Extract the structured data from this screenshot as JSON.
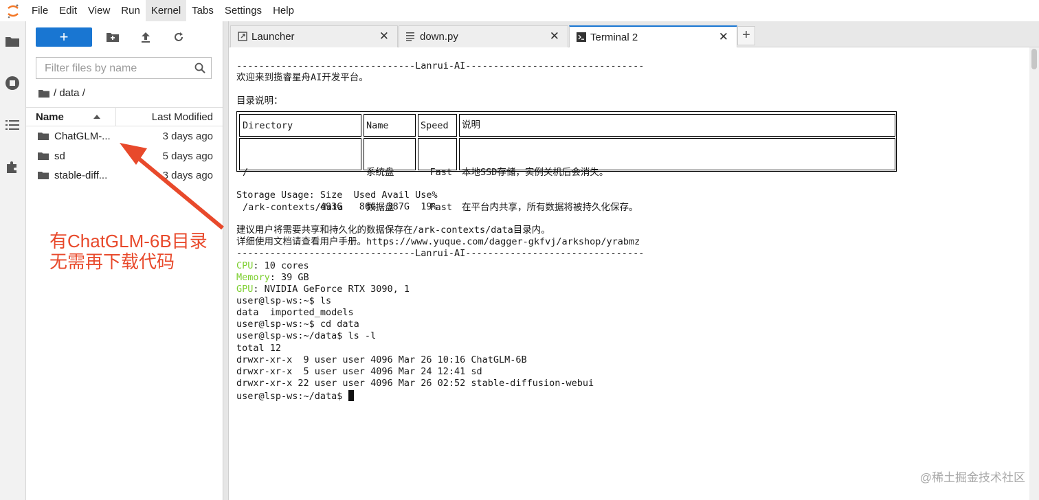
{
  "menu": [
    "File",
    "Edit",
    "View",
    "Run",
    "Kernel",
    "Tabs",
    "Settings",
    "Help"
  ],
  "active_menu_index": 4,
  "filebrowser": {
    "new_label": "+",
    "filter_placeholder": "Filter files by name",
    "breadcrumb": "/ data /",
    "col_name": "Name",
    "col_modified": "Last Modified",
    "files": [
      {
        "name": "ChatGLM-...",
        "modified": "3 days ago"
      },
      {
        "name": "sd",
        "modified": "5 days ago"
      },
      {
        "name": "stable-diff...",
        "modified": "3 days ago"
      }
    ]
  },
  "tabs": [
    {
      "label": "Launcher",
      "icon": "launcher-icon",
      "active": false
    },
    {
      "label": "down.py",
      "icon": "python-file-icon",
      "active": false
    },
    {
      "label": "Terminal 2",
      "icon": "terminal-icon",
      "active": true
    }
  ],
  "add_tab_label": "+",
  "terminal": {
    "banner": "--------------------------------Lanrui-AI--------------------------------",
    "welcome": "欢迎来到揽睿星舟AI开发平台。",
    "dir_heading": "目录说明：",
    "table": {
      "headers": [
        "Directory",
        "Name",
        "Speed",
        "说明"
      ],
      "dirs": [
        "/",
        "/ark-contexts/data"
      ],
      "names": [
        "系统盘",
        "数据盘"
      ],
      "speeds": [
        "Fast",
        "Fast"
      ],
      "descs": [
        "本地SSD存储，实例关机后会消失。",
        "在平台内共享，所有数据将被持久化保存。"
      ]
    },
    "storage_header": "Storage Usage: Size  Used Avail Use%",
    "storage_values": "               493G   86G  387G  19%",
    "advice1": "建议用户将需要共享和持久化的数据保存在/ark-contexts/data目录内。",
    "advice2": "详细使用文档请查看用户手册。https://www.yuque.com/dagger-gkfvj/arkshop/yrabmz",
    "banner2": "--------------------------------Lanrui-AI--------------------------------",
    "cpu_label": "CPU",
    "cpu_value": ": 10 cores",
    "mem_label": "Memory",
    "mem_value": ": 39 GB",
    "gpu_label": "GPU",
    "gpu_value": ": NVIDIA GeForce RTX 3090, 1",
    "lines": [
      "user@lsp-ws:~$ ls",
      "data  imported_models",
      "user@lsp-ws:~$ cd data",
      "user@lsp-ws:~/data$ ls -l",
      "total 12",
      "drwxr-xr-x  9 user user 4096 Mar 26 10:16 ChatGLM-6B",
      "drwxr-xr-x  5 user user 4096 Mar 24 12:41 sd",
      "drwxr-xr-x 22 user user 4096 Mar 26 02:52 stable-diffusion-webui"
    ],
    "prompt": "user@lsp-ws:~/data$ "
  },
  "annotation": {
    "line1": "有ChatGLM-6B目录",
    "line2": "无需再下载代码",
    "color": "#e8492b"
  },
  "watermark": "@稀土掘金技术社区",
  "colors": {
    "accent": "#1976d2",
    "terminal_green": "#7ccf2e"
  }
}
